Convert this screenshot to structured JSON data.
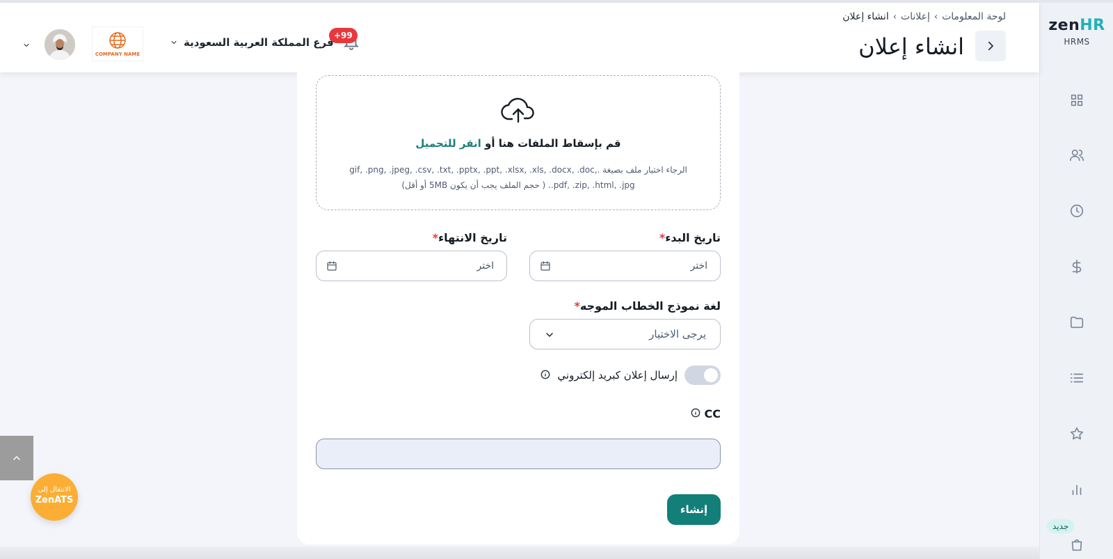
{
  "app": {
    "brand_zen": "zen",
    "brand_hr": "HR",
    "brand_sub": "HRMS",
    "accent": "#127f79"
  },
  "sidebar": {
    "icons": [
      "grid-icon",
      "users-icon",
      "clock-icon",
      "dollar-icon",
      "folder-icon",
      "list-icon",
      "star-icon",
      "bar-chart-icon",
      "bag-icon"
    ],
    "new_badge": "جديد"
  },
  "header": {
    "breadcrumbs": [
      "لوحة المعلومات",
      "إعلانات",
      "انشاء إعلان"
    ],
    "title": "انشاء إعلان",
    "notifications": "+99",
    "branch": "فرع المملكة العربية السعودية",
    "company_name": "COMPANY NAME"
  },
  "upload": {
    "text_before": "قم بإسقاط الملفات هنا أو",
    "link": "انقر للتحميل",
    "hint": "الرجاء اختيار ملف بصيغة .gif, .png, .jpeg, .csv, .txt, .pptx, .ppt, .xlsx, .xls, .docx, .doc, .pdf, .zip, .html, .jpg. ( حجم الملف يجب أن يكون 5MB أو أقل)"
  },
  "form": {
    "start_date": {
      "label": "تاريخ البدء",
      "placeholder": "اختر"
    },
    "end_date": {
      "label": "تاريخ الانتهاء",
      "placeholder": "اختر"
    },
    "language": {
      "label": "لغة نموذج الخطاب الموجه",
      "value": "يرجى الاختيار"
    },
    "email_toggle": {
      "label": "إرسال إعلان كبريد إلكتروني",
      "on": false
    },
    "cc": {
      "label": "CC",
      "value": ""
    },
    "submit": "إنشاء",
    "required_mark": "*"
  },
  "floating": {
    "ats_line1": "الانتقال إلى",
    "ats_line2": "ZenATS"
  }
}
